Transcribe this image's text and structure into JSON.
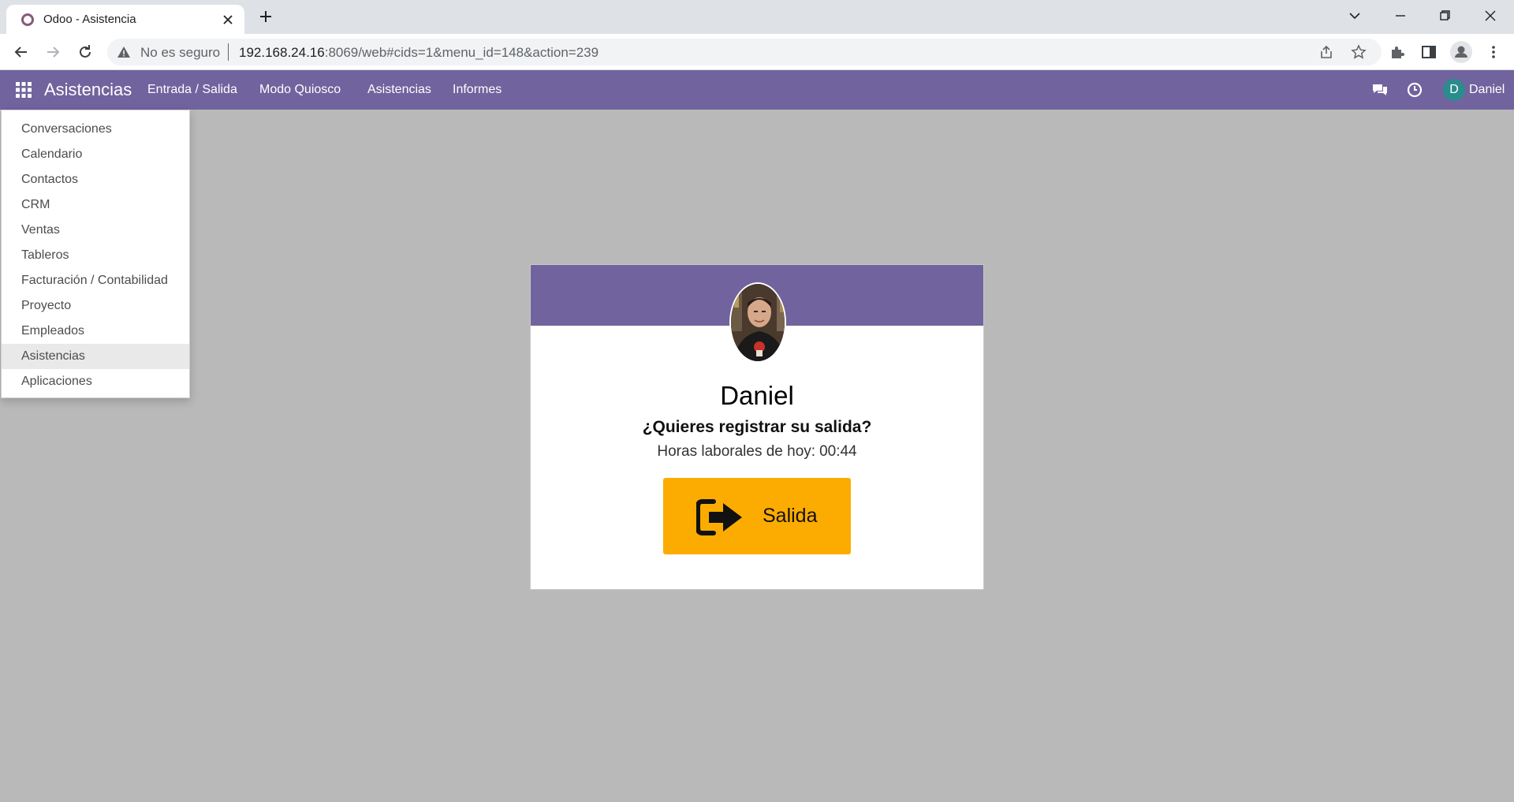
{
  "browser": {
    "tab_title": "Odoo - Asistencia",
    "security_label": "No es seguro",
    "url_host": "192.168.24.16",
    "url_rest": ":8069/web#cids=1&menu_id=148&action=239"
  },
  "navbar": {
    "app_name": "Asistencias",
    "menu": [
      "Entrada / Salida",
      "Modo Quiosco",
      "Asistencias",
      "Informes"
    ],
    "user_initial": "D",
    "user_name": "Daniel",
    "color": "#71639e"
  },
  "apps_menu": {
    "items": [
      "Conversaciones",
      "Calendario",
      "Contactos",
      "CRM",
      "Ventas",
      "Tableros",
      "Facturación / Contabilidad",
      "Proyecto",
      "Empleados",
      "Asistencias",
      "Aplicaciones"
    ],
    "active": "Asistencias"
  },
  "kiosk": {
    "employee_name": "Daniel",
    "question": "¿Quieres registrar su salida?",
    "hours_label": "Horas laborales de hoy:",
    "hours_value": "00:44",
    "checkout_label": "Salida",
    "button_color": "#fcac00"
  }
}
